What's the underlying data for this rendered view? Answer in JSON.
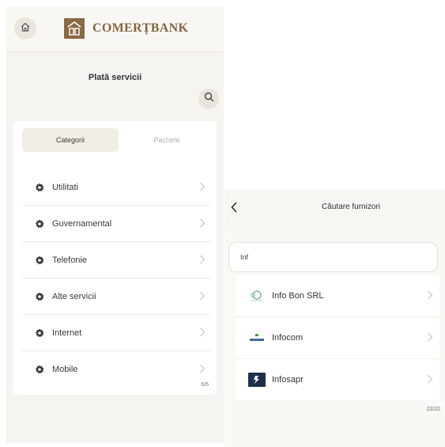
{
  "brand": {
    "name": "COMERȚBANK",
    "color": "#86653f"
  },
  "left": {
    "page_title": "Plată servicii",
    "tabs": [
      {
        "label": "Categorii",
        "active": true
      },
      {
        "label": "Pachete",
        "active": false
      }
    ],
    "categories": [
      {
        "label": "Utilitati",
        "icon": "gear-icon"
      },
      {
        "label": "Guvernamental",
        "icon": "gear-icon"
      },
      {
        "label": "Telefonie",
        "icon": "gear-icon"
      },
      {
        "label": "Alte servicii",
        "icon": "gear-icon"
      },
      {
        "label": "Internet",
        "icon": "gear-icon"
      },
      {
        "label": "Mobile",
        "icon": "gear-icon"
      }
    ],
    "count": "6/6"
  },
  "right": {
    "title": "Căutare furnizori",
    "search": {
      "value": "Inf"
    },
    "results": [
      {
        "name": "Info Bon SRL",
        "logo": "info-bon-logo"
      },
      {
        "name": "Infocom",
        "logo": "infocom-logo"
      },
      {
        "name": "Infosapr",
        "logo": "infosapr-logo"
      }
    ],
    "count": "22/22"
  }
}
